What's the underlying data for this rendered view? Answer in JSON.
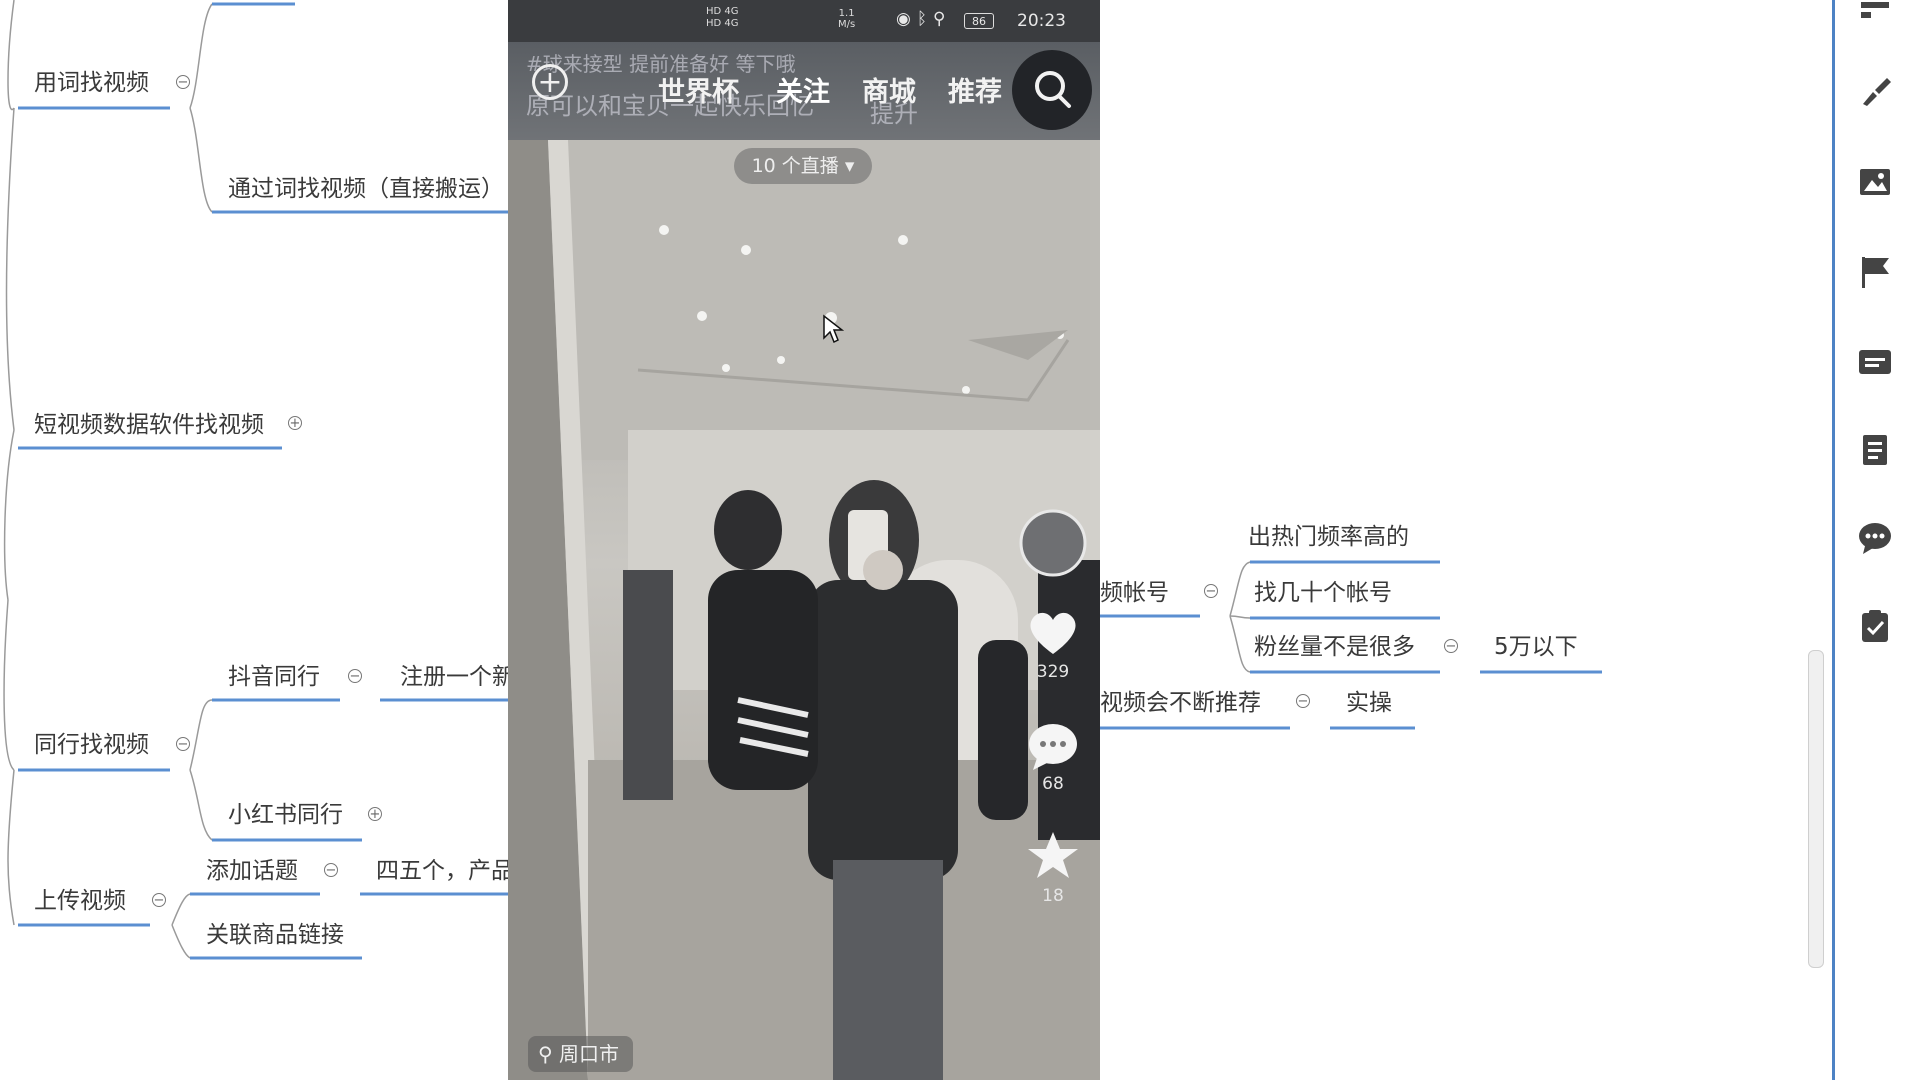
{
  "mindmap": {
    "nodes": {
      "yongci": "用词找视频",
      "tongguoci": "通过词找视频（直接搬运）",
      "duanshipin": "短视频数据软件找视频",
      "tonghang": "同行找视频",
      "douyin": "抖音同行",
      "zhuce": "注册一个新",
      "xiaohongshu": "小红书同行",
      "shangchuan": "上传视频",
      "tianjia": "添加话题",
      "siwuge": "四五个，产品",
      "guanlian": "关联商品链接",
      "pinzhanghao": "频帐号",
      "chure": "出热门频率高的",
      "zhaoji": "找几十个帐号",
      "fensi": "粉丝量不是很多",
      "wuwan": "5万以下",
      "shipinhui": "视频会不断推荐",
      "shicao": "实操"
    },
    "toggles": {
      "collapse": "−",
      "expand": "+"
    }
  },
  "phone": {
    "status": {
      "time": "20:23",
      "battery": "86",
      "network_top": "HD 4G",
      "network_bottom": "HD 4G",
      "speed_top": "1.1",
      "speed_bottom": "M/s"
    },
    "nav": {
      "ghost_line1": "#球来接型   提前准备好   等下哦",
      "ghost_line2": "原可以和宝贝一起快乐回忆",
      "ghost_sub": "提升",
      "tabs": [
        "世界杯",
        "关注",
        "商城",
        "推荐"
      ],
      "active_tab": "关注"
    },
    "live_pill": "10 个直播 ▾",
    "likes": "329",
    "comments": "68",
    "favorites": "18",
    "location": "周口市"
  },
  "colors": {
    "branch_line": "#5b8fd1",
    "connector": "#9a9a9a",
    "toolbar_border": "#4d82c4"
  }
}
